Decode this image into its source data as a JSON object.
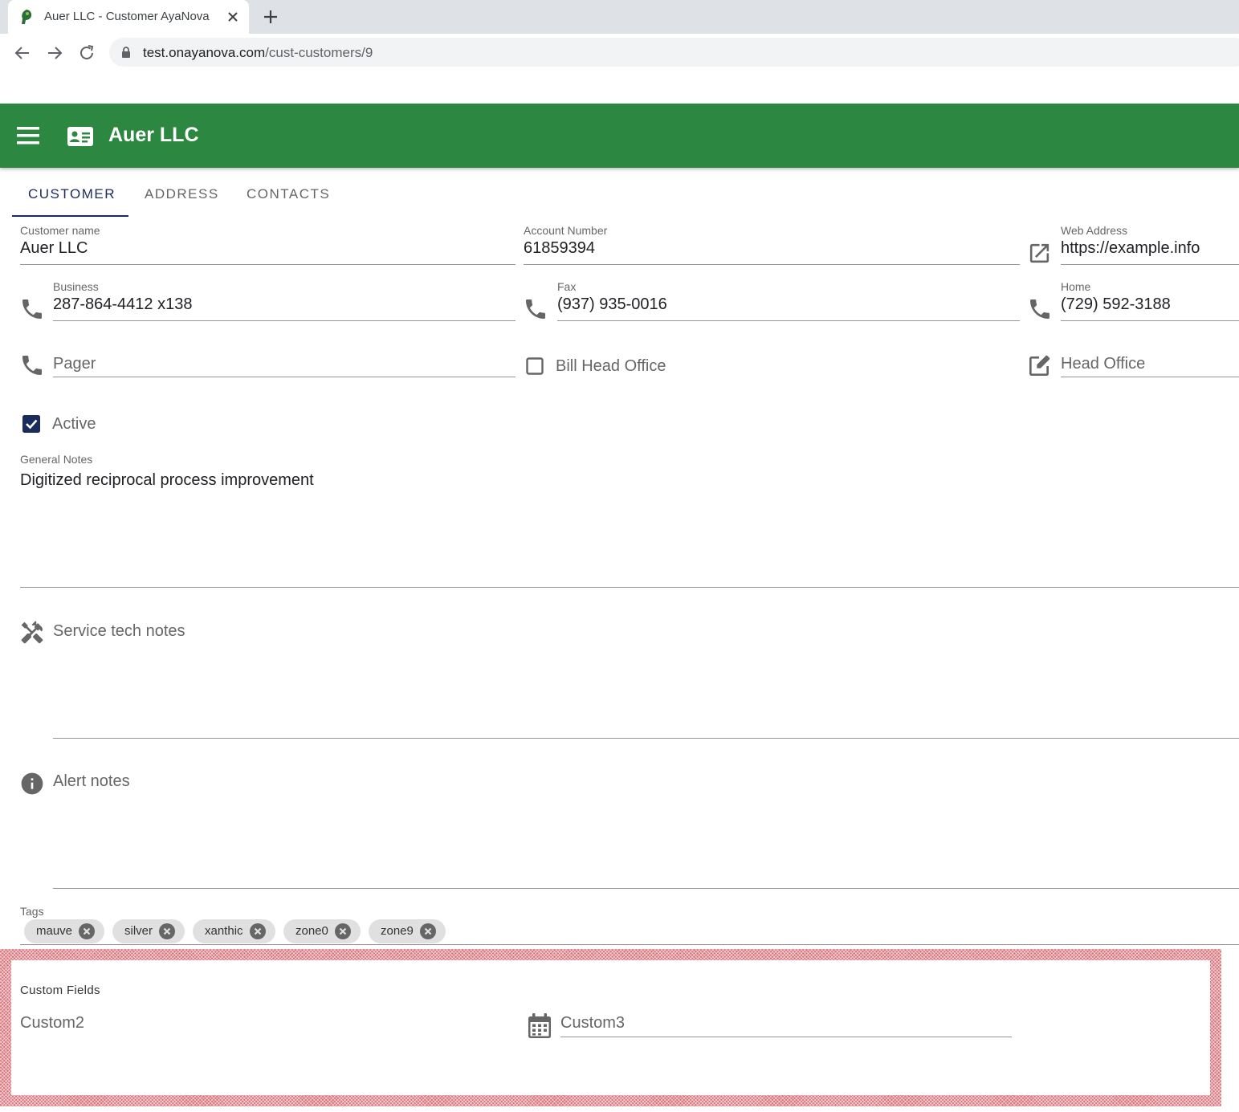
{
  "browser": {
    "tab_title": "Auer LLC - Customer AyaNova",
    "url_domain": "test.onayanova.com",
    "url_path": "/cust-customers/9"
  },
  "appbar": {
    "title": "Auer LLC",
    "color": "#2c8740"
  },
  "tabs": [
    {
      "label": "CUSTOMER",
      "active": true
    },
    {
      "label": "ADDRESS",
      "active": false
    },
    {
      "label": "CONTACTS",
      "active": false
    }
  ],
  "fields": {
    "customer_name": {
      "label": "Customer name",
      "value": "Auer LLC"
    },
    "account_number": {
      "label": "Account Number",
      "value": "61859394"
    },
    "web_address": {
      "label": "Web Address",
      "value": "https://example.info"
    },
    "business": {
      "label": "Business",
      "value": "287-864-4412 x138"
    },
    "fax": {
      "label": "Fax",
      "value": "(937) 935-0016"
    },
    "home": {
      "label": "Home",
      "value": "(729) 592-3188"
    },
    "pager": {
      "placeholder": "Pager"
    },
    "bill_head_office": {
      "label": "Bill Head Office",
      "checked": false
    },
    "head_office": {
      "placeholder": "Head Office"
    },
    "active": {
      "label": "Active",
      "checked": true
    },
    "general_notes": {
      "label": "General Notes",
      "value": "Digitized reciprocal process improvement"
    },
    "service_tech_notes": {
      "placeholder": "Service tech notes"
    },
    "alert_notes": {
      "placeholder": "Alert notes"
    }
  },
  "tags": {
    "label": "Tags",
    "items": [
      "mauve",
      "silver",
      "xanthic",
      "zone0",
      "zone9"
    ]
  },
  "custom_fields": {
    "title": "Custom Fields",
    "custom2": {
      "placeholder": "Custom2"
    },
    "custom3": {
      "placeholder": "Custom3"
    }
  },
  "icons": {
    "favicon": "ayanova-logo-icon",
    "menu": "hamburger-menu-icon",
    "appbar": "contact-card-icon",
    "web": "open-in-new-icon",
    "phone": "phone-icon",
    "head_office": "edit-icon",
    "service": "tools-icon",
    "alert": "info-icon",
    "calendar": "calendar-icon",
    "tag_remove": "close-circle-icon"
  }
}
